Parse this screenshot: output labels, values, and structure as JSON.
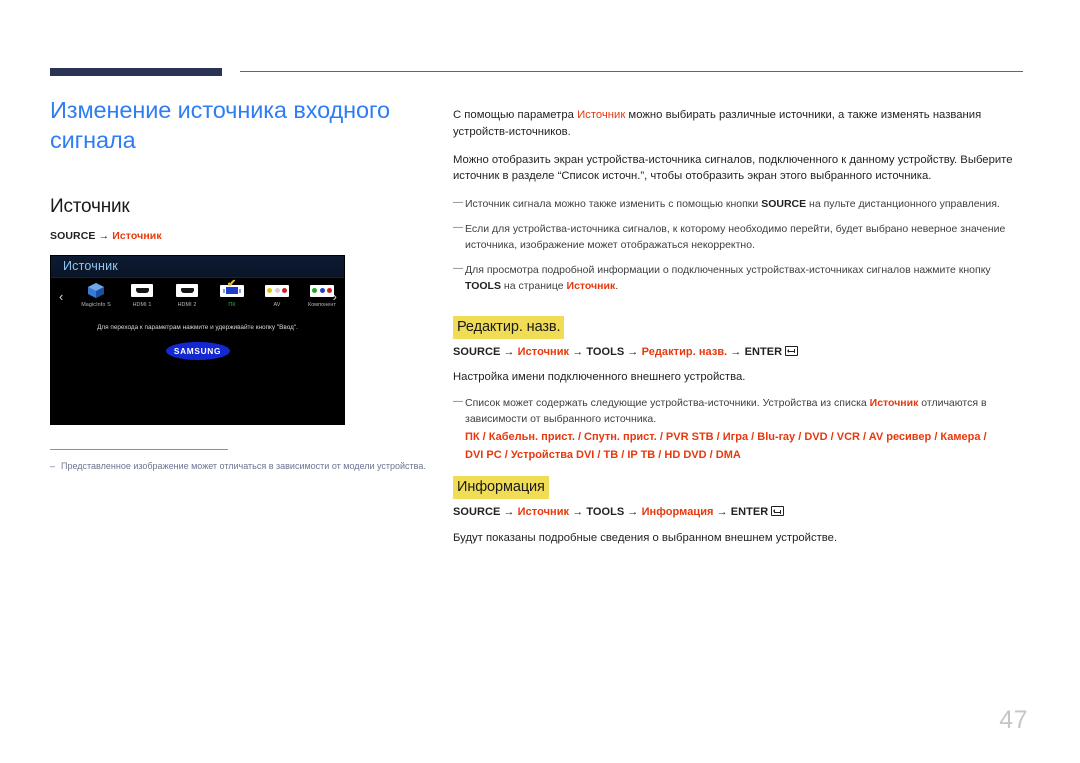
{
  "page": {
    "number": "47"
  },
  "left": {
    "doc_title": "Изменение источника входного сигнала",
    "section_title": "Источник",
    "path": {
      "source": "SOURCE",
      "arrow": "→",
      "target": "Источник"
    },
    "footnote": {
      "dash": "–",
      "text": "Представленное изображение может отличаться в зависимости от модели устройства."
    }
  },
  "tv": {
    "title": "Источник",
    "nav_left": "‹",
    "nav_right": "›",
    "check": "✔",
    "hint": "Для перехода к параметрам нажмите и удерживайте кнопку \"Ввод\".",
    "logo": "SAMSUNG",
    "sources": [
      {
        "label": "MagicInfo S",
        "icon": "magicinfo-icon",
        "selected": false
      },
      {
        "label": "HDMI 1",
        "icon": "hdmi-icon",
        "selected": false
      },
      {
        "label": "HDMI 2",
        "icon": "hdmi-icon",
        "selected": false
      },
      {
        "label": "ПК",
        "icon": "pc-vga-icon",
        "selected": true
      },
      {
        "label": "AV",
        "icon": "rca-av-icon",
        "selected": false
      },
      {
        "label": "Компонент",
        "icon": "rca-component-icon",
        "selected": false
      }
    ]
  },
  "right": {
    "intro_1_a": "С помощью параметра ",
    "intro_1_red": "Источник",
    "intro_1_b": " можно выбирать различные источники, а также изменять названия устройств-источников.",
    "intro_2": "Можно отобразить экран устройства-источника сигналов, подключенного к данному устройству. Выберите источник в разделе “Список источн.”, чтобы отобразить экран этого выбранного источника.",
    "notes": [
      {
        "dash": "—",
        "a": "Источник сигнала можно также изменить с помощью кнопки ",
        "bold": "SOURCE",
        "b": " на пульте дистанционного управления."
      },
      {
        "dash": "—",
        "a": "Если для устройства-источника сигналов, к которому необходимо перейти, будет выбрано неверное значение источника, изображение может отображаться некорректно.",
        "bold": "",
        "b": ""
      },
      {
        "dash": "—",
        "a": "Для просмотра подробной информации о подключенных устройствах-источниках сигналов нажмите кнопку ",
        "bold": "TOOLS",
        "b": " на странице ",
        "red": "Источник",
        "c": "."
      }
    ],
    "edit_name": {
      "heading": "Редактир. назв.",
      "path": {
        "p1": "SOURCE",
        "a1": "→",
        "p2": "Источник",
        "a2": "→",
        "p3": "TOOLS",
        "a3": "→",
        "p4": "Редактир. назв.",
        "a4": "→",
        "p5": "ENTER"
      },
      "desc": "Настройка имени подключенного внешнего устройства.",
      "note": {
        "dash": "—",
        "a": "Список может содержать следующие устройства-источники. Устройства из списка ",
        "red": "Источник",
        "b": " отличаются в зависимости от выбранного источника."
      },
      "device_list_line_1": "ПК / Кабельн. прист. / Спутн. прист. / PVR STB / Игра / Blu-ray / DVD / VCR / AV ресивер / Камера /",
      "device_list_line_2": "DVI PC / Устройства DVI / ТВ / IP ТВ / HD DVD / DMA"
    },
    "information": {
      "heading": "Информация",
      "path": {
        "p1": "SOURCE",
        "a1": "→",
        "p2": "Источник",
        "a2": "→",
        "p3": "TOOLS",
        "a3": "→",
        "p4": "Информация",
        "a4": "→",
        "p5": "ENTER"
      },
      "desc": "Будут показаны подробные сведения о выбранном внешнем устройстве."
    }
  },
  "colors": {
    "accent_blue": "#2f7df4",
    "accent_red": "#e8380d",
    "highlight_yellow": "#f0dc55",
    "header_navy": "#2b3354"
  }
}
